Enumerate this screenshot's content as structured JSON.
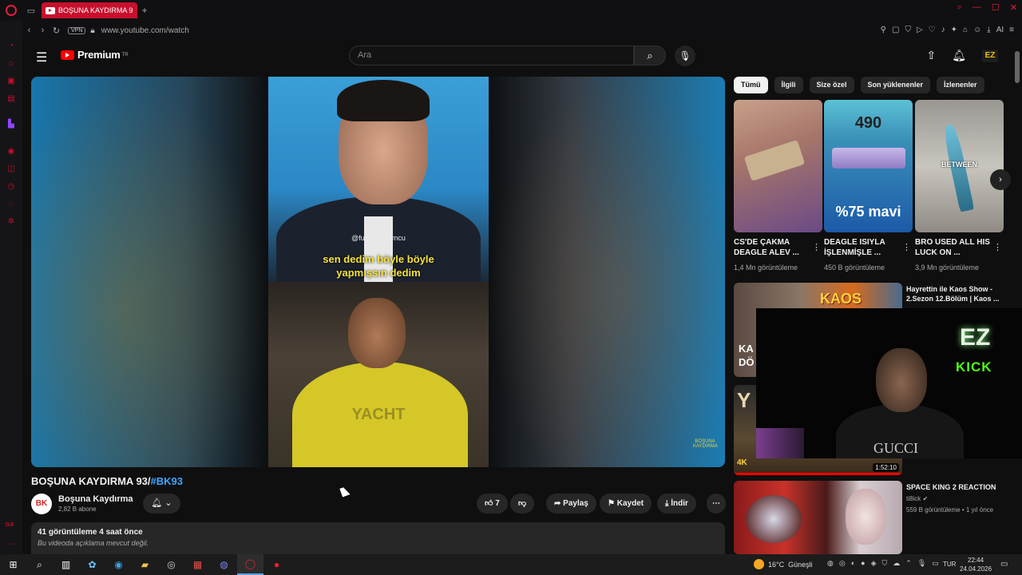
{
  "browser": {
    "tab_title": "BOŞUNA KAYDIRMA 9",
    "vpn": "VPN",
    "url": "www.youtube.com/watch",
    "ext_ai": "AI"
  },
  "youtube": {
    "logo_text": "Premium",
    "region": "TR",
    "search_placeholder": "Ara",
    "avatar_text": "EZ"
  },
  "video": {
    "overlay_watermark": "@futbollyorumcu",
    "caption_line1": "sen dedim böyle böyle",
    "caption_line2": "yapmışsın dedim",
    "jersey_text": "YACHT",
    "corner_watermark": "BOŞUNA KAYDIRMA",
    "title_main": "BOŞUNA KAYDIRMA 93/",
    "title_tag": "#BK93",
    "channel_name": "Boşuna Kaydırma",
    "channel_subs": "2,82 B abone",
    "channel_avatar": "BK",
    "likes": "7",
    "share": "Paylaş",
    "save": "Kaydet",
    "download": "İndir",
    "views_time": "41 görüntüleme  4 saat önce",
    "description": "Bu videoda açıklama mevcut değil."
  },
  "chips": [
    "Tümü",
    "İlgili",
    "Size özel",
    "Son yüklenenler",
    "İzlenenler"
  ],
  "shorts": [
    {
      "title": "CS'DE ÇAKMA DEAGLE ALEV ...",
      "views": "1,4 Mn görüntüleme",
      "overlay": ""
    },
    {
      "title": "DEAGLE ISIYLA İŞLENMİŞLE ...",
      "views": "450 B görüntüleme",
      "overlay_top": "490",
      "overlay_bottom": "%75 mavi"
    },
    {
      "title": "BRO USED ALL HIS LUCK ON ...",
      "views": "3,9 Mn görüntüleme",
      "overlay": "BETWEEN"
    }
  ],
  "recommendations": [
    {
      "title": "Hayrettin ile Kaos Show - 2.Sezon 12.Bölüm | Kaos ...",
      "channel": "",
      "meta": "",
      "thumb_text": "KAOS",
      "side_text": "KA DÖ"
    },
    {
      "title": "",
      "channel": "",
      "meta": "",
      "duration": "1:52:10",
      "thumb_text": "Y",
      "badge": "4K"
    },
    {
      "title": "SPACE KING 2 REACTION",
      "channel": "ti8ick",
      "meta": "559 B görüntüleme • 1 yıl önce"
    }
  ],
  "webcam": {
    "logo": "EZ",
    "kick": "KICK",
    "shirt_text": "GUCCI"
  },
  "taskbar": {
    "temperature": "16°C",
    "weather": "Güneşli",
    "lang": "TUR",
    "time": "22:44",
    "date": "24.04.2026"
  }
}
